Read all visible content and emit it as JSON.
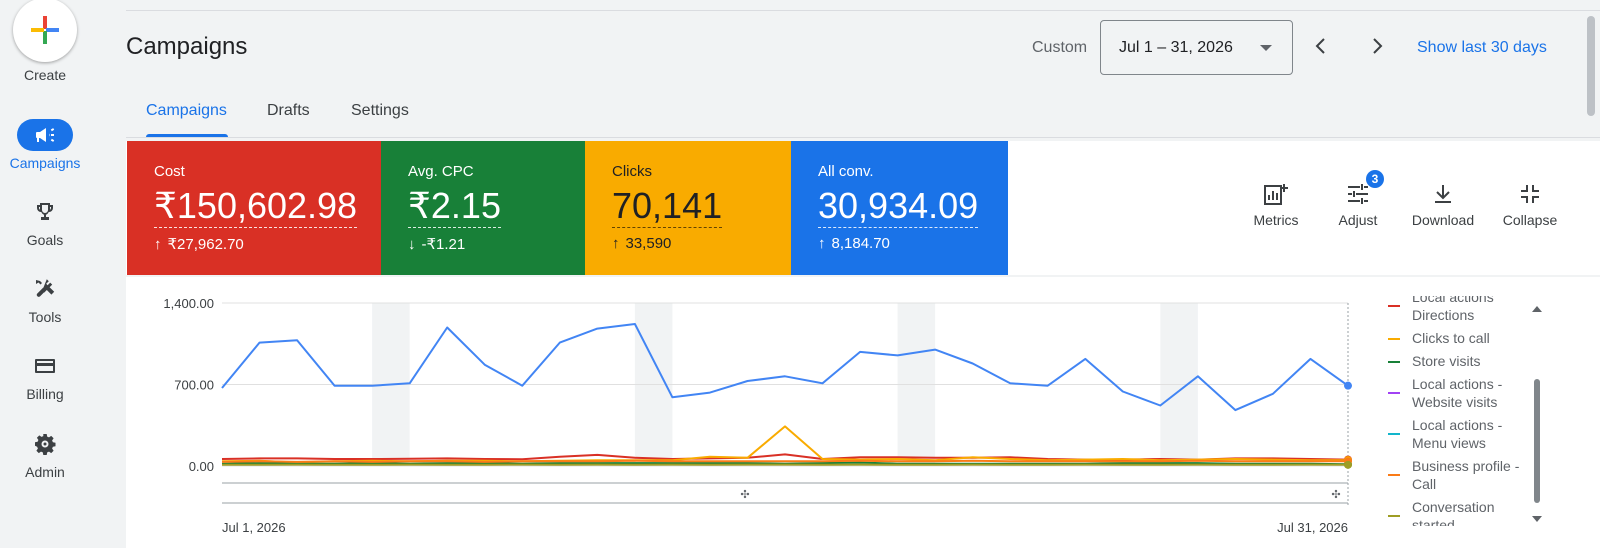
{
  "nav": {
    "create_label": "Create",
    "items": [
      {
        "label": "Campaigns",
        "icon": "megaphone-icon",
        "active": true
      },
      {
        "label": "Goals",
        "icon": "trophy-icon",
        "active": false
      },
      {
        "label": "Tools",
        "icon": "tools-icon",
        "active": false
      },
      {
        "label": "Billing",
        "icon": "credit-card-icon",
        "active": false
      },
      {
        "label": "Admin",
        "icon": "gear-icon",
        "active": false
      }
    ]
  },
  "header": {
    "title": "Campaigns",
    "date_mode": "Custom",
    "date_range": "Jul 1 – 31, 2026",
    "show_last": "Show last 30 days"
  },
  "tabs": [
    {
      "label": "Campaigns",
      "active": true
    },
    {
      "label": "Drafts",
      "active": false
    },
    {
      "label": "Settings",
      "active": false
    }
  ],
  "scorecards": [
    {
      "label": "Cost",
      "value": "₹150,602.98",
      "change": "₹27,962.70",
      "direction": "up",
      "color": "#d93025"
    },
    {
      "label": "Avg. CPC",
      "value": "₹2.15",
      "change": "-₹1.21",
      "direction": "down",
      "color": "#188038"
    },
    {
      "label": "Clicks",
      "value": "70,141",
      "change": "33,590",
      "direction": "up",
      "color": "#f9ab00"
    },
    {
      "label": "All conv.",
      "value": "30,934.09",
      "change": "8,184.70",
      "direction": "up",
      "color": "#1a73e8"
    }
  ],
  "toolbar": {
    "metrics": "Metrics",
    "adjust": "Adjust",
    "adjust_badge": "3",
    "download": "Download",
    "collapse": "Collapse"
  },
  "legend": [
    {
      "label": "Local actions Directions",
      "lines": [
        "Local actions",
        "Directions"
      ],
      "color": "#d93025"
    },
    {
      "label": "Clicks to call",
      "lines": [
        "Clicks to call"
      ],
      "color": "#f9ab00"
    },
    {
      "label": "Store visits",
      "lines": [
        "Store visits"
      ],
      "color": "#188038"
    },
    {
      "label": "Local actions - Website visits",
      "lines": [
        "Local actions -",
        "Website visits"
      ],
      "color": "#a142f4"
    },
    {
      "label": "Local actions - Menu views",
      "lines": [
        "Local actions -",
        "Menu views"
      ],
      "color": "#12b5cb"
    },
    {
      "label": "Business profile - Call",
      "lines": [
        "Business profile -",
        "Call"
      ],
      "color": "#fa7b17"
    },
    {
      "label": "Conversation started",
      "lines": [
        "Conversation",
        "started"
      ],
      "color": "#9e9d24"
    }
  ],
  "chart_data": {
    "type": "line",
    "x_start": "Jul 1, 2026",
    "x_end": "Jul 31, 2026",
    "y_ticks": [
      "1,400.00",
      "700.00",
      "0.00"
    ],
    "ylim": [
      0,
      1400
    ],
    "weekend_bands": [
      [
        4,
        5
      ],
      [
        11,
        12
      ],
      [
        18,
        19
      ],
      [
        25,
        26
      ]
    ],
    "series": [
      {
        "name": "All conv.",
        "color": "#4285f4",
        "values": [
          670,
          1060,
          1080,
          690,
          690,
          710,
          1190,
          870,
          690,
          1060,
          1180,
          1220,
          590,
          630,
          730,
          770,
          710,
          980,
          950,
          1000,
          880,
          710,
          690,
          920,
          640,
          520,
          770,
          480,
          620,
          920,
          690
        ]
      },
      {
        "name": "Local actions Directions",
        "color": "#d93025",
        "values": [
          60,
          65,
          65,
          60,
          60,
          62,
          65,
          60,
          58,
          80,
          95,
          70,
          60,
          65,
          70,
          100,
          60,
          75,
          75,
          70,
          70,
          75,
          60,
          55,
          55,
          60,
          55,
          65,
          65,
          60,
          55
        ]
      },
      {
        "name": "Clicks to call",
        "color": "#f9ab00",
        "values": [
          40,
          45,
          30,
          40,
          45,
          40,
          45,
          45,
          40,
          45,
          50,
          50,
          50,
          80,
          70,
          340,
          60,
          55,
          60,
          50,
          75,
          60,
          50,
          55,
          60,
          50,
          55,
          60,
          55,
          50,
          50
        ]
      },
      {
        "name": "Store visits",
        "color": "#188038",
        "values": [
          20,
          25,
          20,
          20,
          25,
          20,
          25,
          25,
          20,
          25,
          25,
          25,
          25,
          25,
          25,
          20,
          25,
          30,
          20,
          20,
          20,
          20,
          20,
          20,
          25,
          25,
          25,
          20,
          20,
          20,
          15
        ]
      },
      {
        "name": "Business profile - Call",
        "color": "#fa7b17",
        "values": [
          35,
          40,
          35,
          40,
          35,
          40,
          40,
          35,
          40,
          40,
          40,
          45,
          40,
          40,
          40,
          40,
          40,
          45,
          40,
          40,
          45,
          40,
          40,
          40,
          40,
          40,
          45,
          40,
          40,
          40,
          40
        ]
      },
      {
        "name": "Conversation started",
        "color": "#9e9d24",
        "values": [
          10,
          10,
          12,
          10,
          10,
          12,
          10,
          10,
          12,
          10,
          12,
          10,
          12,
          10,
          12,
          12,
          10,
          12,
          10,
          10,
          12,
          10,
          10,
          12,
          10,
          10,
          12,
          10,
          10,
          12,
          10
        ]
      }
    ]
  }
}
